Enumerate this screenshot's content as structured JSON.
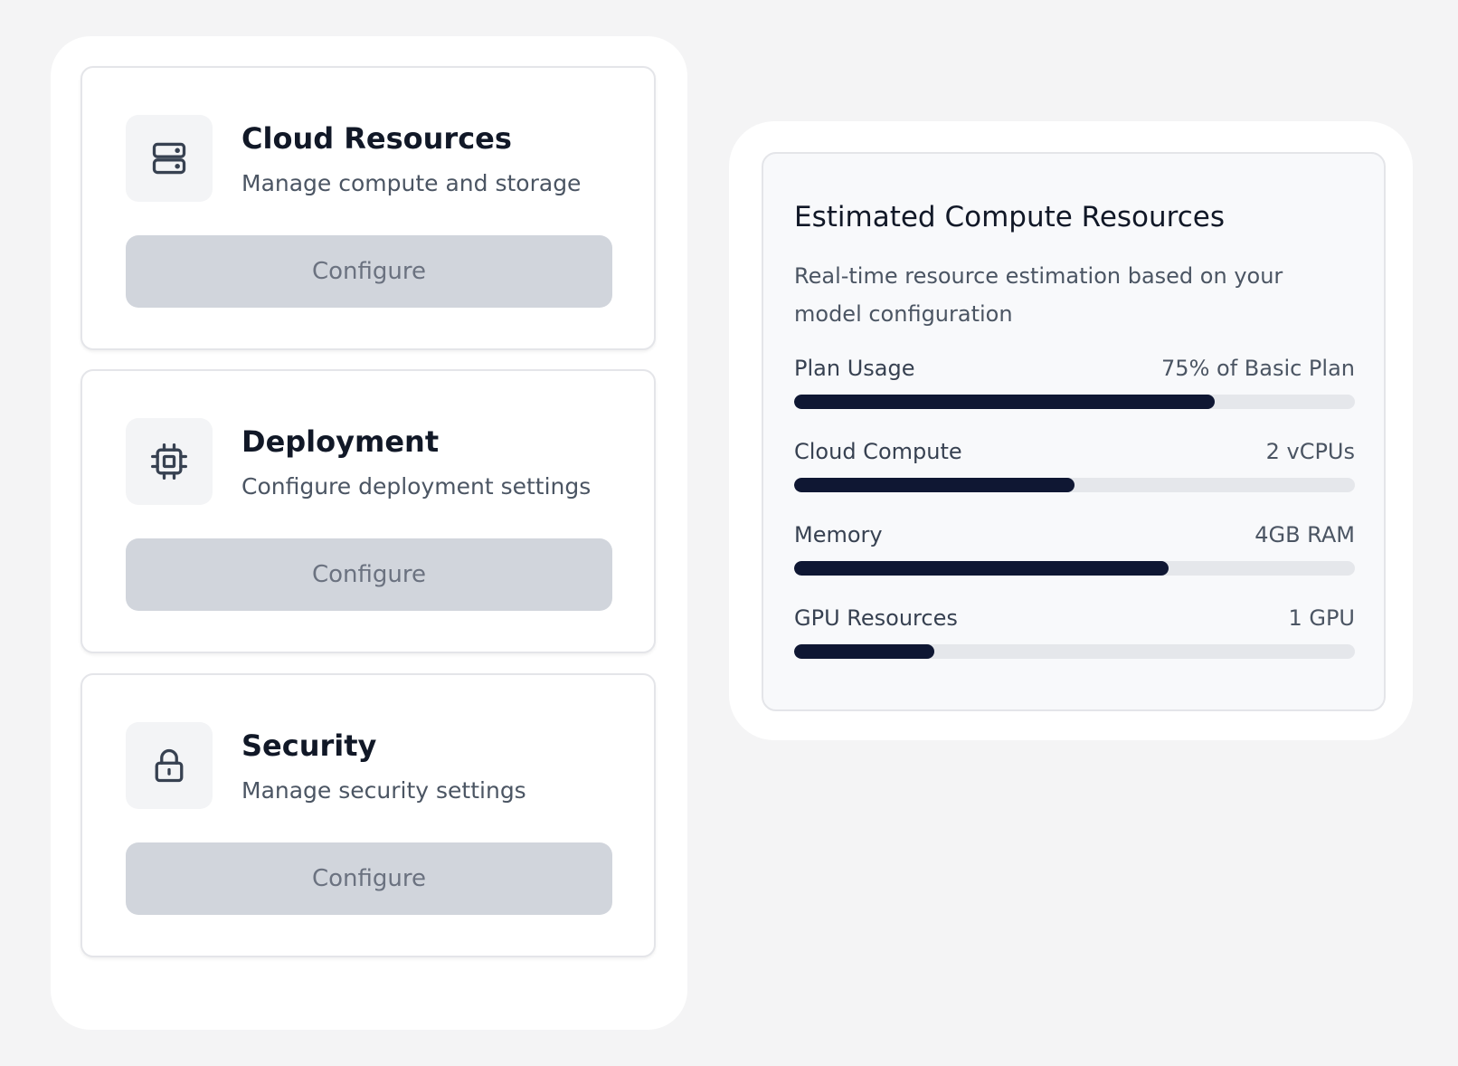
{
  "settings_cards": [
    {
      "title": "Cloud Resources",
      "description": "Manage compute and storage",
      "icon": "server-icon",
      "button_label": "Configure"
    },
    {
      "title": "Deployment",
      "description": "Configure deployment settings",
      "icon": "cpu-chip-icon",
      "button_label": "Configure"
    },
    {
      "title": "Security",
      "description": "Manage security settings",
      "icon": "lock-icon",
      "button_label": "Configure"
    }
  ],
  "estimate": {
    "title": "Estimated Compute Resources",
    "description": "Real-time resource estimation based on your model configuration",
    "metrics": [
      {
        "label": "Plan Usage",
        "value": "75% of Basic Plan",
        "percent": 75
      },
      {
        "label": "Cloud Compute",
        "value": "2 vCPUs",
        "percent": 50
      },
      {
        "label": "Memory",
        "value": "4GB RAM",
        "percent": 66.7
      },
      {
        "label": "GPU Resources",
        "value": "1 GPU",
        "percent": 25
      }
    ]
  },
  "colors": {
    "page_background": "#f4f4f5",
    "bar_fill": "#0f1733",
    "bar_track": "#e5e7eb",
    "button_disabled_bg": "#d1d5dc",
    "button_disabled_text": "#6b7280"
  }
}
